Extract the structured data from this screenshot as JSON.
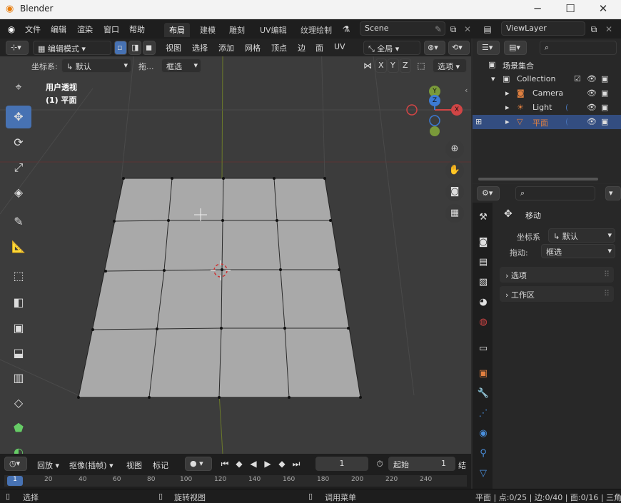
{
  "window": {
    "title": "Blender",
    "minimize": "─",
    "maximize": "☐",
    "close": "✕"
  },
  "menu": [
    "文件",
    "编辑",
    "渲染",
    "窗口",
    "帮助"
  ],
  "workspaces": [
    "布局",
    "建模",
    "雕刻",
    "UV编辑",
    "纹理绘制"
  ],
  "scene": {
    "name": "Scene"
  },
  "viewlayer": {
    "name": "ViewLayer"
  },
  "viewport_header": {
    "mode": "编辑模式",
    "menus": [
      "视图",
      "选择",
      "添加",
      "网格",
      "顶点",
      "边",
      "面",
      "UV"
    ],
    "transform_orientation": "全局"
  },
  "tool_settings": {
    "coord_label": "坐标系:",
    "coord_value": "默认",
    "drag_label": "拖...",
    "drag_value": "框选",
    "axes": [
      "X",
      "Y",
      "Z"
    ],
    "options": "选项"
  },
  "overlay": {
    "view_name": "用户透视",
    "object_name": "(1) 平面"
  },
  "gizmo": {
    "y": "Y",
    "z": "Z",
    "x": "X"
  },
  "outliner": {
    "root": "场景集合",
    "items": [
      {
        "name": "Collection",
        "icon": "collection-icon"
      },
      {
        "name": "Camera",
        "icon": "camera-icon"
      },
      {
        "name": "Light",
        "icon": "light-icon"
      },
      {
        "name": "平面",
        "icon": "mesh-icon"
      }
    ]
  },
  "properties": {
    "tool_name": "移动",
    "coord_label": "坐标系",
    "coord_value": "默认",
    "drag_label": "拖动:",
    "drag_value": "框选",
    "panels": [
      "选项",
      "工作区"
    ]
  },
  "timeline": {
    "playback": "回放",
    "keying": "抠像(插帧)",
    "view": "视图",
    "marker": "标记",
    "current_frame": "1",
    "start_label": "起始",
    "start_value": "1",
    "end_label": "结",
    "ruler": [
      "0",
      "20",
      "40",
      "60",
      "80",
      "100",
      "120",
      "140",
      "160",
      "180",
      "200",
      "220",
      "240"
    ]
  },
  "statusbar": {
    "select": "选择",
    "rotate": "旋转视图",
    "menu": "调用菜单",
    "stats": "平面 | 点:0/25 | 边:0/40 | 面:0/16 | 三角:"
  },
  "colors": {
    "accent": "#4772b3",
    "selected_row": "#334d80",
    "x_axis": "#d04545",
    "y_axis": "#7a9a3a",
    "z_axis": "#3c7bd4"
  }
}
